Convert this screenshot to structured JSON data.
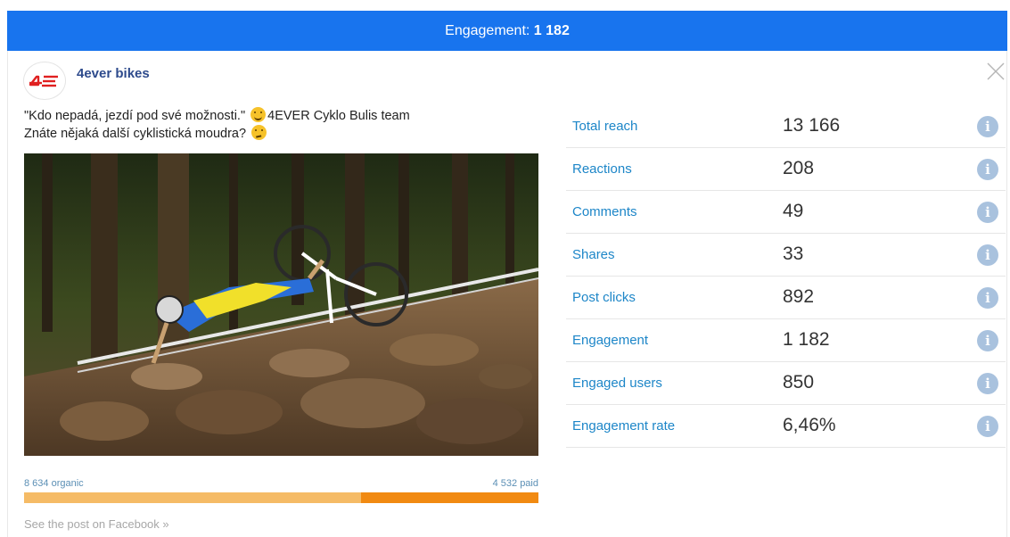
{
  "header": {
    "label": "Engagement:",
    "value": "1 182"
  },
  "page": {
    "name": "4ever bikes",
    "logo_text": "4E"
  },
  "post": {
    "line1": "\"Kdo nepadá, jezdí pod své možnosti.\"",
    "line1_rest": "4EVER Cyklo Bulis team",
    "line2": "Znáte nějaká další cyklistická moudra?",
    "emoji_1": "smiley-emoji",
    "emoji_2": "thinking-emoji"
  },
  "reach": {
    "organic_label": "8 634 organic",
    "paid_label": "4 532 paid",
    "organic": 8634,
    "paid": 4532
  },
  "footer_link": "See the post on Facebook »",
  "stats": [
    {
      "label": "Total reach",
      "value": "13 166"
    },
    {
      "label": "Reactions",
      "value": "208"
    },
    {
      "label": "Comments",
      "value": "49"
    },
    {
      "label": "Shares",
      "value": "33"
    },
    {
      "label": "Post clicks",
      "value": "892"
    },
    {
      "label": "Engagement",
      "value": "1 182"
    },
    {
      "label": "Engaged users",
      "value": "850"
    },
    {
      "label": "Engagement rate",
      "value": "6,46%"
    }
  ],
  "colors": {
    "header": "#1874ee",
    "organic": "#f5bb66",
    "paid": "#f18a12",
    "stat_label": "#1d86c8",
    "logo_red": "#e02020"
  }
}
